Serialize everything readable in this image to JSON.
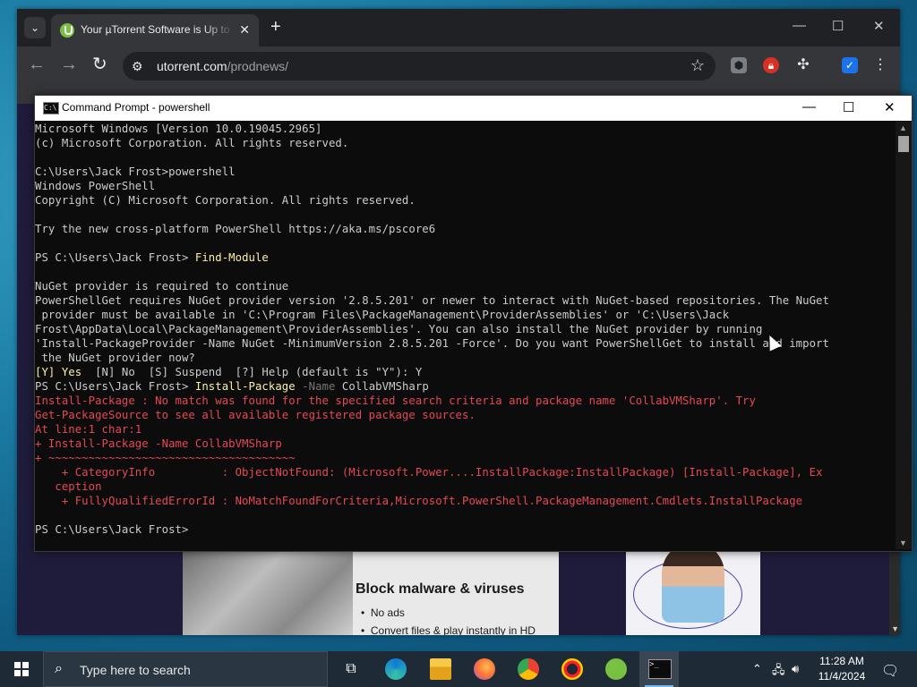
{
  "browser": {
    "tab_title": "Your µTorrent Software is Up to Date",
    "tab_close": "✕",
    "new_tab": "+",
    "url_domain": "utorrent.com",
    "url_path": "/prodnews/",
    "window_controls": [
      "—",
      "☐",
      "✕"
    ]
  },
  "page": {
    "promo_heading": "Block malware & viruses",
    "promo_items": [
      "No ads",
      "Convert files & play instantly in HD"
    ]
  },
  "cmd": {
    "title": "Command Prompt - powershell",
    "icon_text": "C:\\",
    "window_controls": [
      "—",
      "☐",
      "✕"
    ],
    "lines": [
      [
        {
          "t": "Microsoft Windows [Version 10.0.19045.2965]"
        }
      ],
      [
        {
          "t": "(c) Microsoft Corporation. All rights reserved."
        }
      ],
      [
        {
          "t": ""
        }
      ],
      [
        {
          "t": "C:\\Users\\Jack Frost>powershell"
        }
      ],
      [
        {
          "t": "Windows PowerShell"
        }
      ],
      [
        {
          "t": "Copyright (C) Microsoft Corporation. All rights reserved."
        }
      ],
      [
        {
          "t": ""
        }
      ],
      [
        {
          "t": "Try the new cross-platform PowerShell https://aka.ms/pscore6"
        }
      ],
      [
        {
          "t": ""
        }
      ],
      [
        {
          "t": "PS C:\\Users\\Jack Frost> "
        },
        {
          "t": "Find-Module",
          "c": "y"
        }
      ],
      [
        {
          "t": ""
        }
      ],
      [
        {
          "t": "NuGet provider is required to continue"
        }
      ],
      [
        {
          "t": "PowerShellGet requires NuGet provider version '2.8.5.201' or newer to interact with NuGet-based repositories. The NuGet"
        }
      ],
      [
        {
          "t": " provider must be available in 'C:\\Program Files\\PackageManagement\\ProviderAssemblies' or 'C:\\Users\\Jack"
        }
      ],
      [
        {
          "t": "Frost\\AppData\\Local\\PackageManagement\\ProviderAssemblies'. You can also install the NuGet provider by running"
        }
      ],
      [
        {
          "t": "'Install-PackageProvider -Name NuGet -MinimumVersion 2.8.5.201 -Force'. Do you want PowerShellGet to install and import"
        }
      ],
      [
        {
          "t": " the NuGet provider now?"
        }
      ],
      [
        {
          "t": "[Y] Yes",
          "c": "y"
        },
        {
          "t": "  [N] No  [S] Suspend  [?] Help (default is \"Y\"): Y"
        }
      ],
      [
        {
          "t": "PS C:\\Users\\Jack Frost> "
        },
        {
          "t": "Install-Package",
          "c": "y"
        },
        {
          "t": " -Name",
          "c": "g"
        },
        {
          "t": " CollabVMSharp"
        }
      ],
      [
        {
          "t": "Install-Package : No match was found for the specified search criteria and package name 'CollabVMSharp'. Try",
          "c": "r"
        }
      ],
      [
        {
          "t": "Get-PackageSource to see all available registered package sources.",
          "c": "r"
        }
      ],
      [
        {
          "t": "At line:1 char:1",
          "c": "r"
        }
      ],
      [
        {
          "t": "+ Install-Package -Name CollabVMSharp",
          "c": "r"
        }
      ],
      [
        {
          "t": "+ ~~~~~~~~~~~~~~~~~~~~~~~~~~~~~~~~~~~~~",
          "c": "r"
        }
      ],
      [
        {
          "t": "    + CategoryInfo          : ObjectNotFound: (Microsoft.Power....InstallPackage:InstallPackage) [Install-Package], Ex",
          "c": "r"
        }
      ],
      [
        {
          "t": "   ception",
          "c": "r"
        }
      ],
      [
        {
          "t": "    + FullyQualifiedErrorId : NoMatchFoundForCriteria,Microsoft.PowerShell.PackageManagement.Cmdlets.InstallPackage",
          "c": "r"
        }
      ],
      [
        {
          "t": ""
        }
      ],
      [
        {
          "t": "PS C:\\Users\\Jack Frost> "
        }
      ]
    ]
  },
  "taskbar": {
    "search_placeholder": "Type here to search",
    "time": "11:28 AM",
    "date": "11/4/2024",
    "tray_icons": [
      "chevron-up-icon",
      "network-icon",
      "volume-icon",
      "notification-icon"
    ],
    "apps": [
      "task-view",
      "edge",
      "file-explorer",
      "firefox",
      "chrome",
      "opera",
      "utorrent",
      "command-prompt"
    ]
  },
  "colors": {
    "console_text": "#cccccc",
    "console_yellow": "#f9f1a5",
    "console_red": "#e74856",
    "taskbar": "#1e2a36"
  }
}
